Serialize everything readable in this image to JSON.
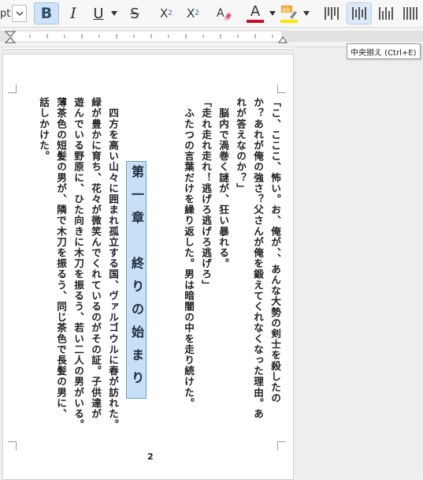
{
  "toolbar": {
    "font_size_fragment": "pt",
    "bold_label": "B",
    "italic_label": "I",
    "underline_label": "U",
    "strike_label": "S",
    "superscript_base": "X",
    "superscript_mark": "2",
    "subscript_base": "X",
    "subscript_mark": "2",
    "font_color_glyph": "A",
    "font_color": "#c8102e",
    "highlight_glyph": "ab",
    "highlight_color": "#ffe600",
    "active_button_color": "#cfe3f7"
  },
  "tooltip": {
    "text": "中央揃え (Ctrl+E)"
  },
  "document": {
    "page_number": "2",
    "column_1": "「こ、こここ、怖い。お、俺が、、あんな大勢の剣士を殺したの",
    "column_2": "か？あれが俺の強さ？父さんが俺を鍛えてくれなくなった理由。あ",
    "column_3": "れが答えなのか？」",
    "column_4": "　脳内で渦巻く謎が、狂い暴れる。",
    "column_5": "「走れ走れ走れ！逃げろ逃げろ逃げろ」",
    "column_6": "　ふたつの言葉だけを繰り返した。男は暗闇の中を走り続けた。",
    "chapter_title": "第一章　終りの始まり",
    "column_7": "　四方を高い山々に囲まれ孤立する国、ヴァルゴウルに春が訪れた。",
    "column_8": "緑が豊かに育ち、花々が微笑んでくれているのがその証。子供達が",
    "column_9": "遊んでいる野原に、ひた向きに木刀を振るう、若い二人の男がいる。",
    "column_10": "薄茶色の短髪の男が、隣で木刀を振るう、同じ茶色で長髪の男に、",
    "column_11": "話しかけた。"
  }
}
